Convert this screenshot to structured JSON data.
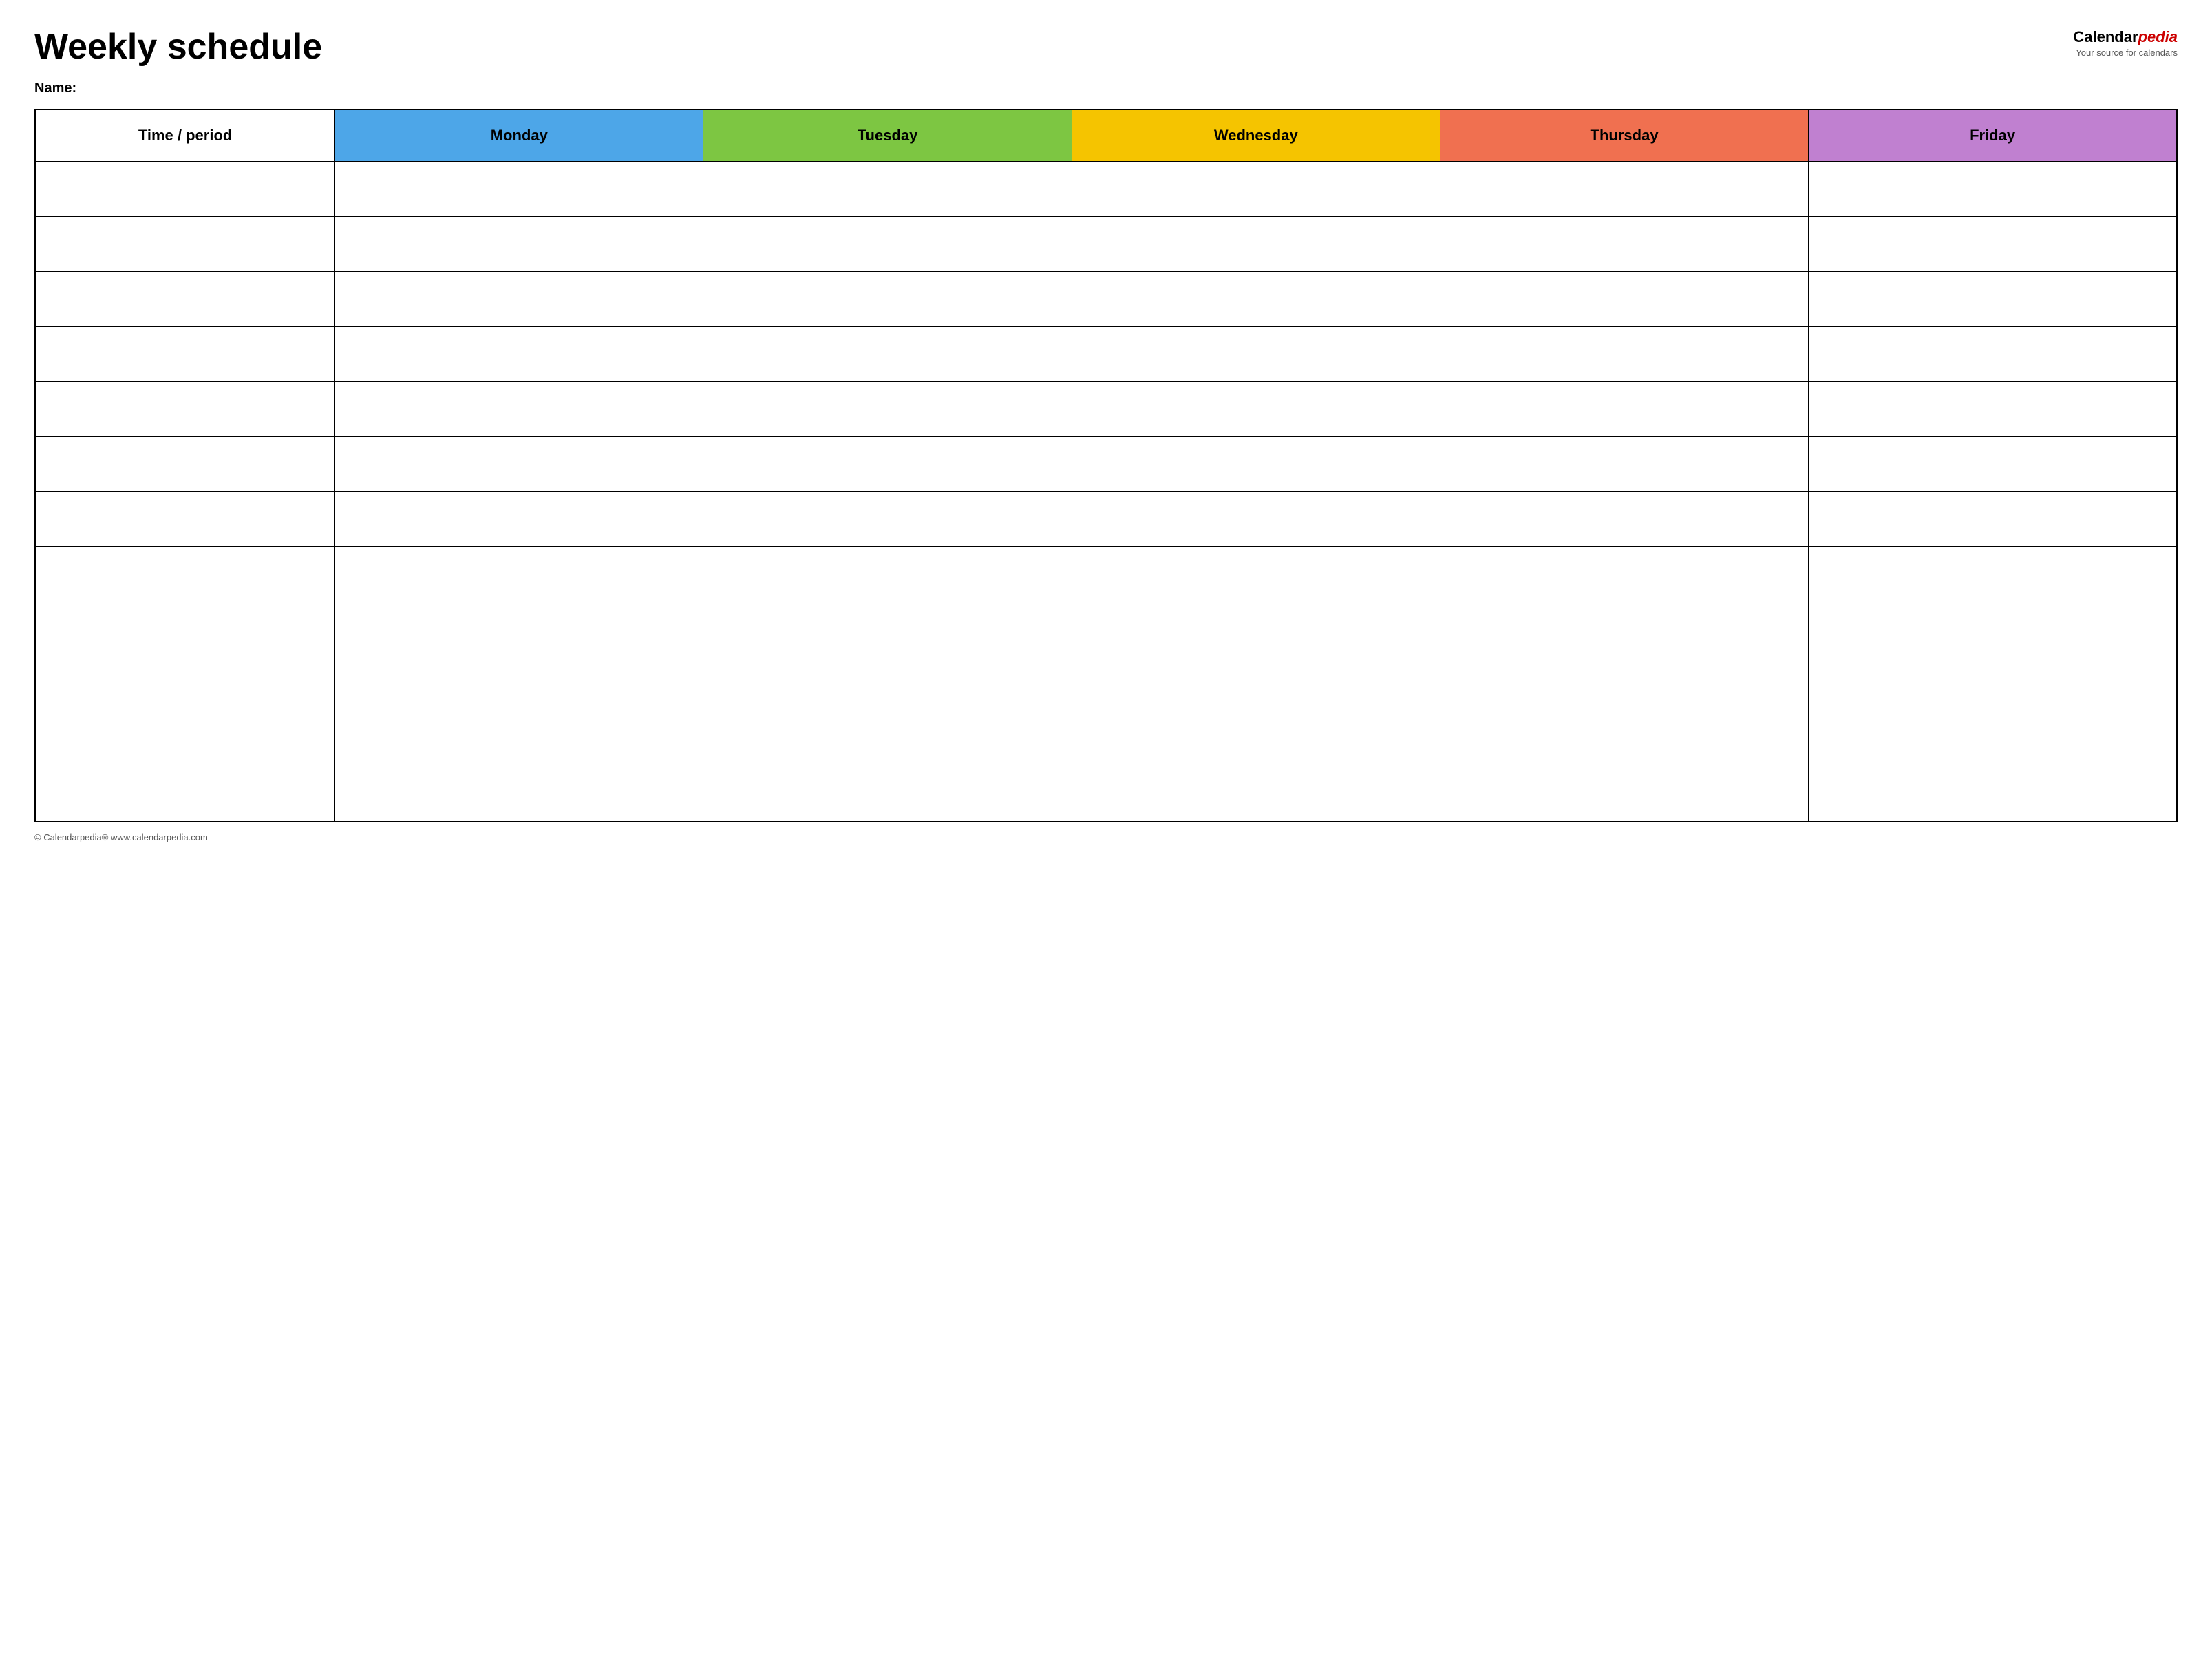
{
  "header": {
    "title": "Weekly schedule",
    "logo": {
      "calendar_text": "Calendar",
      "pedia_text": "pedia",
      "tagline": "Your source for calendars"
    },
    "name_label": "Name:"
  },
  "table": {
    "columns": [
      {
        "id": "time",
        "label": "Time / period",
        "color": "#ffffff"
      },
      {
        "id": "monday",
        "label": "Monday",
        "color": "#4da6e8"
      },
      {
        "id": "tuesday",
        "label": "Tuesday",
        "color": "#7dc642"
      },
      {
        "id": "wednesday",
        "label": "Wednesday",
        "color": "#f5c400"
      },
      {
        "id": "thursday",
        "label": "Thursday",
        "color": "#f07050"
      },
      {
        "id": "friday",
        "label": "Friday",
        "color": "#c080d0"
      }
    ],
    "rows": 12
  },
  "footer": {
    "copyright": "© Calendarpedia®  www.calendarpedia.com"
  }
}
